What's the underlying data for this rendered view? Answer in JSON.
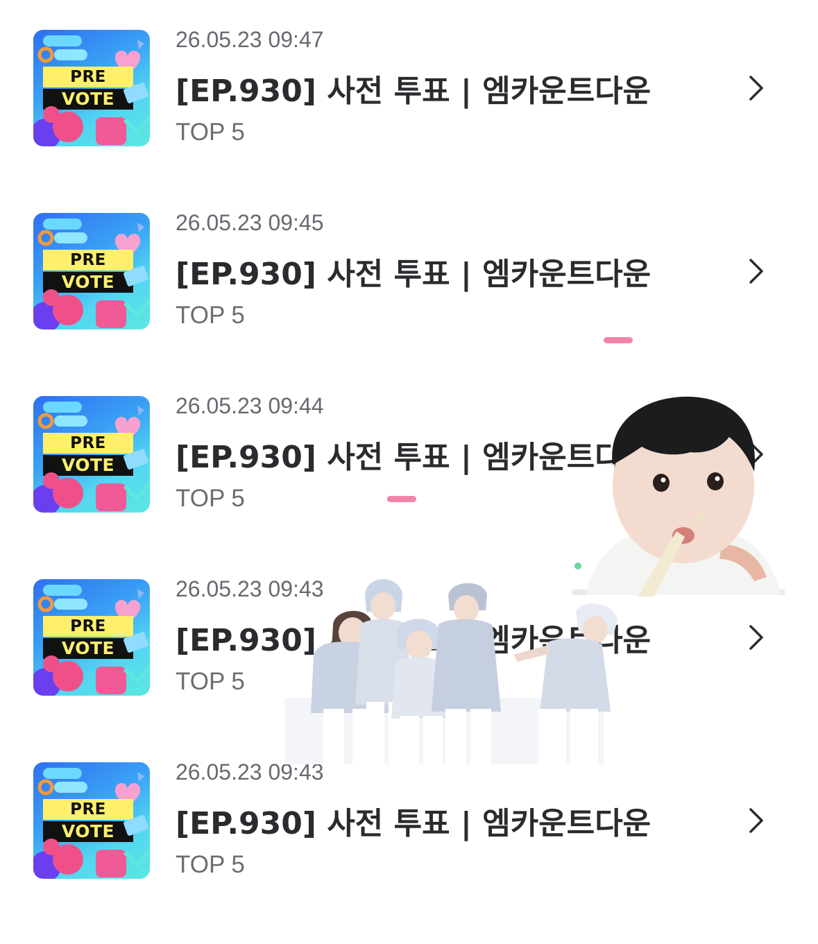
{
  "thumbnail": {
    "line1": "PRE",
    "line2": "VOTE"
  },
  "items": [
    {
      "date": "26.05.23 09:47",
      "title": "[EP.930] 사전 투표 | 엠카운트다운",
      "subtitle": "TOP 5"
    },
    {
      "date": "26.05.23 09:45",
      "title": "[EP.930] 사전 투표 | 엠카운트다운",
      "subtitle": "TOP 5"
    },
    {
      "date": "26.05.23 09:44",
      "title": "[EP.930] 사전 투표 | 엠카운트다운",
      "subtitle": "TOP 5"
    },
    {
      "date": "26.05.23 09:43",
      "title": "[EP.930] 사전 투표 | 엠카운트다운",
      "subtitle": "TOP 5"
    },
    {
      "date": "26.05.23 09:43",
      "title": "[EP.930] 사전 투표 | 엠카운트다운",
      "subtitle": "TOP 5"
    }
  ],
  "icons": {
    "row_action": "chevron-right-icon"
  },
  "colors": {
    "title": "#2a2b2e",
    "date": "#666a70",
    "subtitle": "#6a6d72",
    "thumb_blue": "#2f6ff0",
    "thumb_yellow": "#fff06b",
    "thumb_pink": "#f05a96",
    "highlight_pink": "#ef6f9b"
  }
}
